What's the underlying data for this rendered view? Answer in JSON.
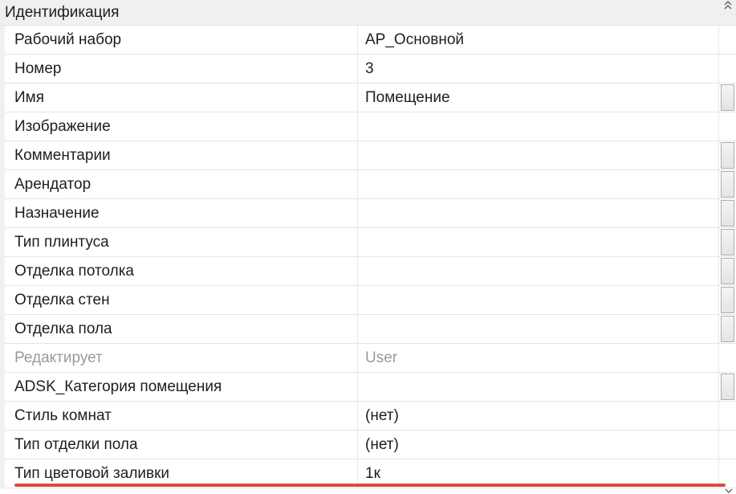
{
  "group": {
    "title": "Идентификация"
  },
  "rows": [
    {
      "name": "Рабочий набор",
      "value": "АР_Основной",
      "readonly": false,
      "edit_button": false
    },
    {
      "name": "Номер",
      "value": "3",
      "readonly": false,
      "edit_button": false
    },
    {
      "name": "Имя",
      "value": "Помещение",
      "readonly": false,
      "edit_button": true
    },
    {
      "name": "Изображение",
      "value": "",
      "readonly": false,
      "edit_button": false
    },
    {
      "name": "Комментарии",
      "value": "",
      "readonly": false,
      "edit_button": true
    },
    {
      "name": "Арендатор",
      "value": "",
      "readonly": false,
      "edit_button": true
    },
    {
      "name": "Назначение",
      "value": "",
      "readonly": false,
      "edit_button": true
    },
    {
      "name": "Тип плинтуса",
      "value": "",
      "readonly": false,
      "edit_button": true
    },
    {
      "name": "Отделка потолка",
      "value": "",
      "readonly": false,
      "edit_button": true
    },
    {
      "name": "Отделка стен",
      "value": "",
      "readonly": false,
      "edit_button": true
    },
    {
      "name": "Отделка пола",
      "value": "",
      "readonly": false,
      "edit_button": true
    },
    {
      "name": "Редактирует",
      "value": "User",
      "readonly": true,
      "edit_button": false
    },
    {
      "name": "ADSK_Категория помещения",
      "value": "",
      "readonly": false,
      "edit_button": true
    },
    {
      "name": "Стиль комнат",
      "value": "(нет)",
      "readonly": false,
      "edit_button": false
    },
    {
      "name": "Тип отделки пола",
      "value": "(нет)",
      "readonly": false,
      "edit_button": false
    },
    {
      "name": "Тип цветовой заливки",
      "value": "1к",
      "readonly": false,
      "edit_button": false
    }
  ],
  "icons": {
    "collapse": "chevron-double-up-icon",
    "scroll_down": "chevron-down-icon"
  },
  "colors": {
    "header_bg": "#f0f0f0",
    "grid_line": "#e6e6e6",
    "text": "#1e1e1e",
    "readonly_text": "#9a9a9a",
    "highlight": "#d94b3f"
  }
}
